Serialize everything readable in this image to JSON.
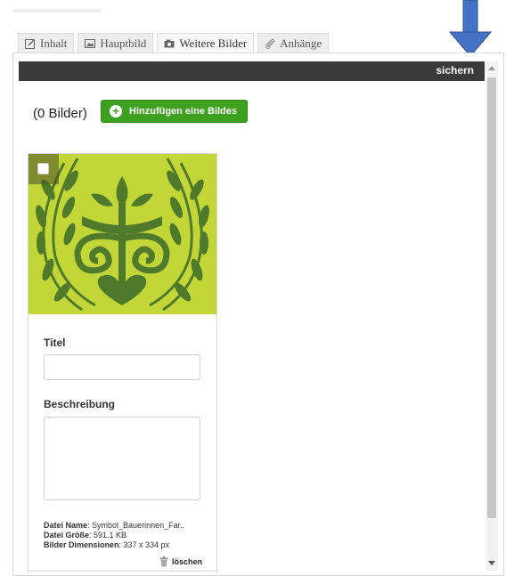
{
  "tabs": [
    {
      "label": "Inhalt",
      "icon": "edit-icon"
    },
    {
      "label": "Hauptbild",
      "icon": "image-icon"
    },
    {
      "label": "Weitere Bilder",
      "icon": "camera-icon"
    },
    {
      "label": "Anhänge",
      "icon": "paperclip-icon"
    }
  ],
  "toolbar": {
    "save_label": "sichern"
  },
  "gallery": {
    "count_label": "(0 Bilder)",
    "add_button_label": "Hinzufügen eine Bildes"
  },
  "card": {
    "title_label": "Titel",
    "description_label": "Beschreibung",
    "file_name_label": "Datei Name",
    "file_name_value": ": Symbol_Bauerinnen_Far..",
    "file_size_label": "Datei Größe",
    "file_size_value": ": 591.1 KB",
    "dimensions_label": "Bilder Dimensionen",
    "dimensions_value": ": 337 x 334 px",
    "delete_label": "löschen"
  },
  "colors": {
    "accent_green": "#3ea01f",
    "image_background": "#c3d637",
    "toolbar_background": "#3a3a3a",
    "annotation_arrow": "#4472c4"
  }
}
